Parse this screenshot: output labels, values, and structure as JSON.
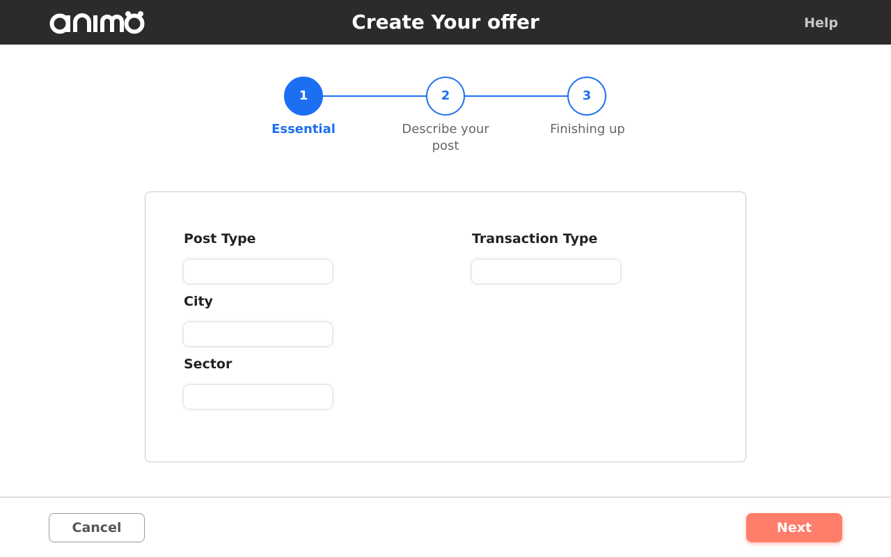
{
  "header": {
    "logo_text": "animo",
    "title": "Create Your offer",
    "help_label": "Help"
  },
  "stepper": {
    "steps": [
      {
        "number": "1",
        "label": "Essential",
        "active": true
      },
      {
        "number": "2",
        "label": "Describe your post",
        "active": false
      },
      {
        "number": "3",
        "label": "Finishing up",
        "active": false
      }
    ]
  },
  "form": {
    "post_type": {
      "label": "Post Type",
      "value": ""
    },
    "transaction_type": {
      "label": "Transaction Type",
      "value": ""
    },
    "city": {
      "label": "City",
      "value": ""
    },
    "sector": {
      "label": "Sector",
      "value": ""
    }
  },
  "footer": {
    "cancel_label": "Cancel",
    "next_label": "Next"
  },
  "colors": {
    "header_bg": "#2b2b2b",
    "accent_blue": "#1d6ff2",
    "next_button": "#ff7d6b"
  }
}
